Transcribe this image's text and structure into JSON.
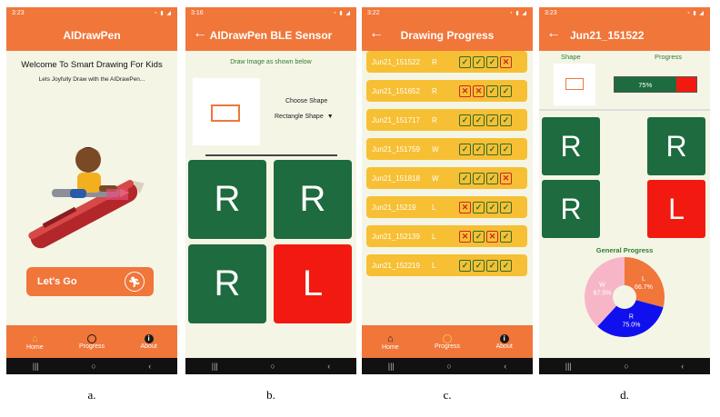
{
  "screens": {
    "a": {
      "time": "3:23",
      "title": "AIDrawPen",
      "welcome": "Welcome To Smart Drawing For Kids",
      "subtitle": "Lets Joyfully Draw with the AIDrawPen...",
      "button": "Let's Go",
      "caption": "a."
    },
    "b": {
      "time": "3:16",
      "title": "AIDrawPen BLE Sensor",
      "instruction": "Draw Image as shown below",
      "choose_label": "Choose Shape",
      "selected_shape": "Rectangle Shape",
      "tiles": [
        "R",
        "R",
        "R",
        "L"
      ],
      "tile_colors": [
        "#1d6b3e",
        "#1d6b3e",
        "#1d6b3e",
        "#f21a10"
      ],
      "caption": "b."
    },
    "c": {
      "time": "3:22",
      "title": "Drawing Progress",
      "rows": [
        {
          "name": "Jun21_151522",
          "letter": "R",
          "marks": [
            "ok",
            "ok",
            "ok",
            "bad"
          ]
        },
        {
          "name": "Jun21_151652",
          "letter": "R",
          "marks": [
            "bad",
            "bad",
            "ok",
            "ok"
          ]
        },
        {
          "name": "Jun21_151717",
          "letter": "R",
          "marks": [
            "ok",
            "ok",
            "ok",
            "ok"
          ]
        },
        {
          "name": "Jun21_151759",
          "letter": "W",
          "marks": [
            "ok",
            "ok",
            "ok",
            "ok"
          ]
        },
        {
          "name": "Jun21_151818",
          "letter": "W",
          "marks": [
            "ok",
            "ok",
            "ok",
            "bad"
          ]
        },
        {
          "name": "Jun21_15219",
          "letter": "L",
          "marks": [
            "bad",
            "ok",
            "ok",
            "ok"
          ]
        },
        {
          "name": "Jun21_152139",
          "letter": "L",
          "marks": [
            "bad",
            "ok",
            "bad",
            "ok"
          ]
        },
        {
          "name": "Jun21_152219",
          "letter": "L",
          "marks": [
            "ok",
            "ok",
            "ok",
            "ok"
          ]
        }
      ],
      "caption": "c."
    },
    "d": {
      "time": "3:23",
      "title": "Jun21_151522",
      "shape_label": "Shape",
      "progress_label": "Progress",
      "progress_value": 75,
      "progress_text": "75%",
      "tiles": [
        "R",
        "R",
        "R",
        "L"
      ],
      "tile_colors": [
        "#1d6b3e",
        "#1d6b3e",
        "#1d6b3e",
        "#f21a10"
      ],
      "general_progress_label": "General Progress",
      "caption": "d."
    }
  },
  "nav": {
    "home": "Home",
    "progress": "Progress",
    "about": "About"
  },
  "colors": {
    "accent": "#f0763a",
    "background": "#f5f5e6",
    "tile_green": "#1d6b3e",
    "tile_red": "#f21a10",
    "row_yellow": "#f7bf33"
  },
  "chart_data": {
    "type": "pie",
    "title": "General Progress",
    "slices": [
      {
        "label": "L",
        "value": 66.7,
        "text": "66.7%",
        "color": "#f0763a"
      },
      {
        "label": "R",
        "value": 75.0,
        "text": "75.0%",
        "color": "#1010ee"
      },
      {
        "label": "W",
        "value": 87.5,
        "text": "87.5%",
        "color": "#f7b6c8"
      }
    ]
  }
}
